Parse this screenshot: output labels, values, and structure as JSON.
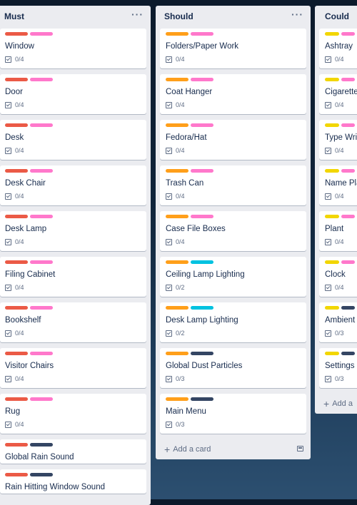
{
  "colors": {
    "red": "#eb5a46",
    "pink": "#ff78cb",
    "orange": "#ff9f1a",
    "teal": "#00c2e0",
    "navy": "#344563",
    "yellow": "#f2d600"
  },
  "menu_glyph": "···",
  "add_card": {
    "plus": "+",
    "label": "Add a card",
    "label_clipped": "Add a"
  },
  "lists": [
    {
      "title": "Must",
      "cards": [
        {
          "title": "Window",
          "labels": [
            "red",
            "pink"
          ],
          "checklist": "0/4"
        },
        {
          "title": "Door",
          "labels": [
            "red",
            "pink"
          ],
          "checklist": "0/4"
        },
        {
          "title": "Desk",
          "labels": [
            "red",
            "pink"
          ],
          "checklist": "0/4"
        },
        {
          "title": "Desk Chair",
          "labels": [
            "red",
            "pink"
          ],
          "checklist": "0/4"
        },
        {
          "title": "Desk Lamp",
          "labels": [
            "red",
            "pink"
          ],
          "checklist": "0/4"
        },
        {
          "title": "Filing Cabinet",
          "labels": [
            "red",
            "pink"
          ],
          "checklist": "0/4"
        },
        {
          "title": "Bookshelf",
          "labels": [
            "red",
            "pink"
          ],
          "checklist": "0/4"
        },
        {
          "title": "Visitor Chairs",
          "labels": [
            "red",
            "pink"
          ],
          "checklist": "0/4"
        },
        {
          "title": "Rug",
          "labels": [
            "red",
            "pink"
          ],
          "checklist": "0/4"
        },
        {
          "title": "Global Rain Sound",
          "labels": [
            "red",
            "navy"
          ],
          "checklist": ""
        },
        {
          "title": "Rain Hitting Window Sound",
          "labels": [
            "red",
            "navy"
          ],
          "checklist": ""
        }
      ]
    },
    {
      "title": "Should",
      "cards": [
        {
          "title": "Folders/Paper Work",
          "labels": [
            "orange",
            "pink"
          ],
          "checklist": "0/4"
        },
        {
          "title": "Coat Hanger",
          "labels": [
            "orange",
            "pink"
          ],
          "checklist": "0/4"
        },
        {
          "title": "Fedora/Hat",
          "labels": [
            "orange",
            "pink"
          ],
          "checklist": "0/4"
        },
        {
          "title": "Trash Can",
          "labels": [
            "orange",
            "pink"
          ],
          "checklist": "0/4"
        },
        {
          "title": "Case File Boxes",
          "labels": [
            "orange",
            "pink"
          ],
          "checklist": "0/4"
        },
        {
          "title": "Ceiling Lamp Lighting",
          "labels": [
            "orange",
            "teal"
          ],
          "checklist": "0/2"
        },
        {
          "title": "Desk Lamp Lighting",
          "labels": [
            "orange",
            "teal"
          ],
          "checklist": "0/2"
        },
        {
          "title": "Global Dust Particles",
          "labels": [
            "orange",
            "navy"
          ],
          "checklist": "0/3"
        },
        {
          "title": "Main Menu",
          "labels": [
            "orange",
            "navy"
          ],
          "checklist": "0/3"
        }
      ]
    },
    {
      "title": "Could",
      "cards": [
        {
          "title": "Ashtray",
          "labels": [
            "yellow",
            "pink"
          ],
          "checklist": "0/4"
        },
        {
          "title": "Cigarette",
          "labels": [
            "yellow",
            "pink"
          ],
          "checklist": "0/4"
        },
        {
          "title": "Type Writ",
          "labels": [
            "yellow",
            "pink"
          ],
          "checklist": "0/4"
        },
        {
          "title": "Name Pla",
          "labels": [
            "yellow",
            "pink"
          ],
          "checklist": "0/4"
        },
        {
          "title": "Plant",
          "labels": [
            "yellow",
            "pink"
          ],
          "checklist": "0/4"
        },
        {
          "title": "Clock",
          "labels": [
            "yellow",
            "pink"
          ],
          "checklist": "0/4"
        },
        {
          "title": "Ambient",
          "labels": [
            "yellow",
            "navy"
          ],
          "checklist": "0/3"
        },
        {
          "title": "Settings",
          "labels": [
            "yellow",
            "navy"
          ],
          "checklist": "0/3"
        }
      ]
    }
  ]
}
